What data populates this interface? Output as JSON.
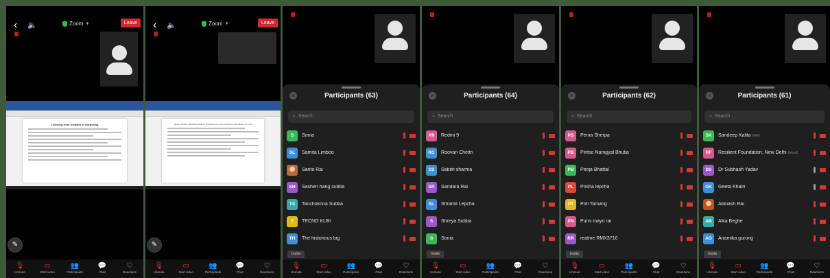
{
  "meeting": {
    "zoom_label": "Zoom",
    "leave_label": "Leave",
    "doc_title": "Learning from Disaster in Darjeeling",
    "doc_title_2": "Report Tertiary Landslide Disaster Management in the Darjeeling Hills Region of India"
  },
  "toolbar": [
    "Unmute",
    "Start video",
    "Participants",
    "Chat",
    "Reactions"
  ],
  "sheets": [
    {
      "title": "Participants (63)",
      "search_placeholder": "Search",
      "invite_label": "Invite",
      "participants": [
        {
          "initials": "S",
          "name": "Sonia",
          "color": "#3bb85a"
        },
        {
          "initials": "SL",
          "name": "Samita Limboo",
          "color": "#3d8fd6"
        },
        {
          "initials": "",
          "name": "Sarita Rai",
          "color": "#b36b45"
        },
        {
          "initials": "SH",
          "name": "Sashen hang subba",
          "color": "#9a59c9"
        },
        {
          "initials": "TS",
          "name": "Tanchokona Subba",
          "color": "#3aaaa8"
        },
        {
          "initials": "T",
          "name": "TECNO KL8h",
          "color": "#e0b91c"
        },
        {
          "initials": "TH",
          "name": "The historious big",
          "color": "#3d8fd6"
        }
      ]
    },
    {
      "title": "Participants (64)",
      "search_placeholder": "Search",
      "invite_label": "Invite",
      "participants": [
        {
          "initials": "R9",
          "name": "Redmi 9",
          "color": "#d85a8c"
        },
        {
          "initials": "RC",
          "name": "Roovan Chettri",
          "color": "#3d8fd6"
        },
        {
          "initials": "SS",
          "name": "Sabitri sharma",
          "color": "#3d8fd6"
        },
        {
          "initials": "SR",
          "name": "Sandara Rai",
          "color": "#9a59c9"
        },
        {
          "initials": "SL",
          "name": "Shramil Lepcha",
          "color": "#3d8fd6"
        },
        {
          "initials": "S",
          "name": "Shreya Subba",
          "color": "#9a59c9"
        },
        {
          "initials": "S",
          "name": "Sonia",
          "color": "#3bb85a"
        }
      ]
    },
    {
      "title": "Participants (62)",
      "search_placeholder": "Search",
      "invite_label": "Invite",
      "participants": [
        {
          "initials": "PS",
          "name": "Pema Sherpa",
          "color": "#d85a8c"
        },
        {
          "initials": "PB",
          "name": "Pintso Namgyal Bhutia",
          "color": "#d85a8c"
        },
        {
          "initials": "PB",
          "name": "Pooja Bhattal",
          "color": "#3bb85a"
        },
        {
          "initials": "PL",
          "name": "Prisha lepcha",
          "color": "#e0453a"
        },
        {
          "initials": "PT",
          "name": "Priti Tamang",
          "color": "#e0b91c"
        },
        {
          "initials": "PN",
          "name": "Purni mayo rai",
          "color": "#d85a8c"
        },
        {
          "initials": "RR",
          "name": "realme RMX3710",
          "color": "#9a59c9"
        }
      ]
    },
    {
      "title": "Participants (61)",
      "search_placeholder": "Search",
      "invite_label": "Invite",
      "participants": [
        {
          "initials": "SK",
          "name": "Sandeep Kalita",
          "tag": "(Me)",
          "color": "#3bb85a"
        },
        {
          "initials": "RF",
          "name": "Resilient Foundation, New Delhi",
          "tag": "(Host)",
          "color": "#d85a8c"
        },
        {
          "initials": "DS",
          "name": "Dr Subhash Yadav",
          "color": "#9a59c9",
          "mic": "gray"
        },
        {
          "initials": "GK",
          "name": "Geeta Khatri",
          "color": "#3d8fd6",
          "mic": "gray"
        },
        {
          "initials": "",
          "name": "Abinash Rai",
          "color": "#c9501f"
        },
        {
          "initials": "AB",
          "name": "Alka Beghe",
          "color": "#3aaaa8"
        },
        {
          "initials": "AG",
          "name": "Anamika gurung",
          "color": "#3d8fd6"
        }
      ]
    }
  ]
}
